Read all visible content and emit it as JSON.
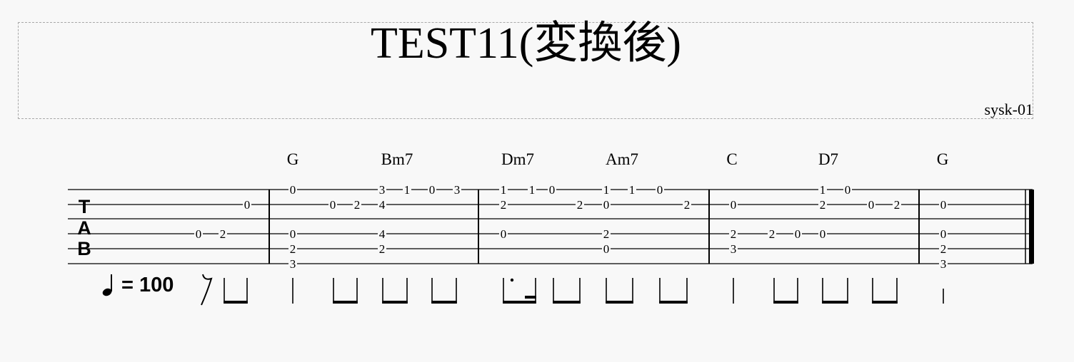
{
  "title": "TEST11(変換後)",
  "composer": "sysk-01",
  "tempo": {
    "value": "100",
    "equals": "="
  },
  "tab_clef": [
    "T",
    "A",
    "B"
  ],
  "chords": [
    "G",
    "Bm7",
    "Dm7",
    "Am7",
    "C",
    "D7",
    "G"
  ],
  "notes": [
    {
      "s": 4,
      "f": "0"
    },
    {
      "s": 4,
      "f": "2"
    },
    {
      "s": 2,
      "f": "0"
    },
    {
      "s": 1,
      "f": "0"
    },
    {
      "s": 4,
      "f": "0"
    },
    {
      "s": 5,
      "f": "2"
    },
    {
      "s": 6,
      "f": "3"
    },
    {
      "s": 2,
      "f": "0"
    },
    {
      "s": 2,
      "f": "2"
    },
    {
      "s": 1,
      "f": "3"
    },
    {
      "s": 2,
      "f": "4"
    },
    {
      "s": 4,
      "f": "4"
    },
    {
      "s": 5,
      "f": "2"
    },
    {
      "s": 1,
      "f": "1"
    },
    {
      "s": 1,
      "f": "0"
    },
    {
      "s": 1,
      "f": "3"
    },
    {
      "s": 1,
      "f": "1"
    },
    {
      "s": 2,
      "f": "2"
    },
    {
      "s": 4,
      "f": "0"
    },
    {
      "s": 1,
      "f": "1"
    },
    {
      "s": 1,
      "f": "0"
    },
    {
      "s": 2,
      "f": "2"
    },
    {
      "s": 1,
      "f": "1"
    },
    {
      "s": 2,
      "f": "0"
    },
    {
      "s": 4,
      "f": "2"
    },
    {
      "s": 5,
      "f": "0"
    },
    {
      "s": 1,
      "f": "1"
    },
    {
      "s": 1,
      "f": "0"
    },
    {
      "s": 2,
      "f": "2"
    },
    {
      "s": 2,
      "f": "0"
    },
    {
      "s": 4,
      "f": "2"
    },
    {
      "s": 5,
      "f": "3"
    },
    {
      "s": 4,
      "f": "2"
    },
    {
      "s": 4,
      "f": "0"
    },
    {
      "s": 4,
      "f": "0"
    },
    {
      "s": 1,
      "f": "1"
    },
    {
      "s": 2,
      "f": "2"
    },
    {
      "s": 1,
      "f": "0"
    },
    {
      "s": 2,
      "f": "0"
    },
    {
      "s": 2,
      "f": "2"
    },
    {
      "s": 2,
      "f": "0"
    },
    {
      "s": 4,
      "f": "0"
    },
    {
      "s": 5,
      "f": "2"
    },
    {
      "s": 6,
      "f": "3"
    }
  ]
}
